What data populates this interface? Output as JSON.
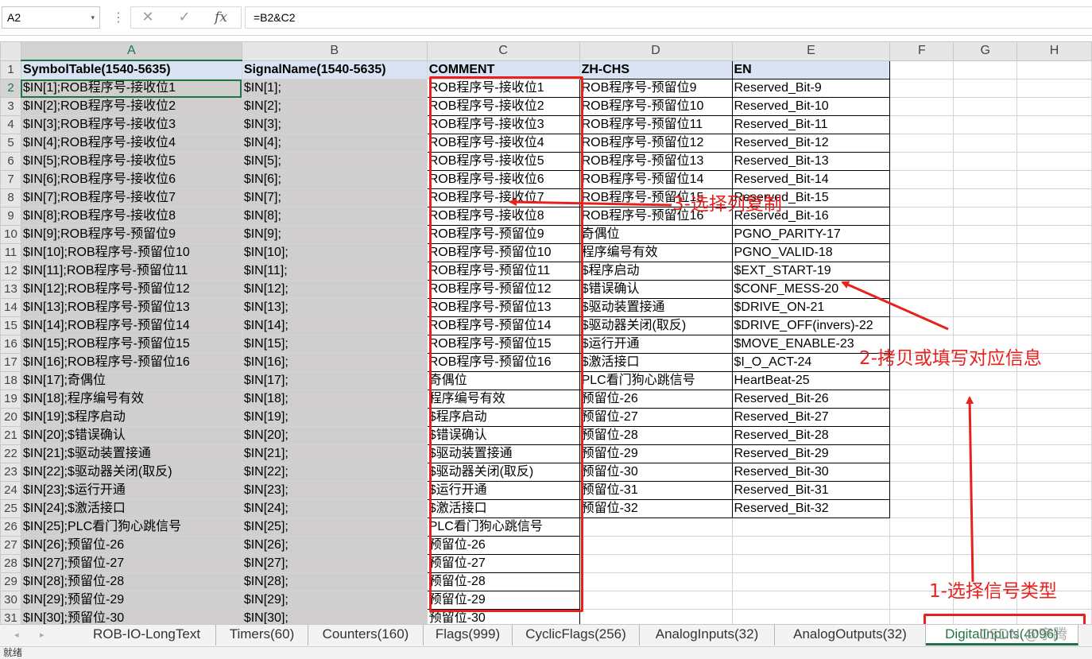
{
  "formula_bar": {
    "name_box": "A2",
    "name_box_arrow": "▾",
    "separator": "⋮",
    "cancel_icon": "✕",
    "confirm_icon": "✓",
    "fx_icon": "fx",
    "formula": "=B2&C2"
  },
  "columns": [
    "A",
    "B",
    "C",
    "D",
    "E",
    "F",
    "G",
    "H"
  ],
  "rows": [
    {
      "num": "1",
      "cells": [
        "SymbolTable(1540-5635)",
        "SignalName(1540-5635)",
        "COMMENT",
        "ZH-CHS",
        "EN"
      ]
    },
    {
      "num": "2",
      "cells": [
        "$IN[1];ROB程序号-接收位1",
        "$IN[1];",
        "ROB程序号-接收位1",
        "ROB程序号-预留位9",
        "Reserved_Bit-9"
      ]
    },
    {
      "num": "3",
      "cells": [
        "$IN[2];ROB程序号-接收位2",
        "$IN[2];",
        "ROB程序号-接收位2",
        "ROB程序号-预留位10",
        "Reserved_Bit-10"
      ]
    },
    {
      "num": "4",
      "cells": [
        "$IN[3];ROB程序号-接收位3",
        "$IN[3];",
        "ROB程序号-接收位3",
        "ROB程序号-预留位11",
        "Reserved_Bit-11"
      ]
    },
    {
      "num": "5",
      "cells": [
        "$IN[4];ROB程序号-接收位4",
        "$IN[4];",
        "ROB程序号-接收位4",
        "ROB程序号-预留位12",
        "Reserved_Bit-12"
      ]
    },
    {
      "num": "6",
      "cells": [
        "$IN[5];ROB程序号-接收位5",
        "$IN[5];",
        "ROB程序号-接收位5",
        "ROB程序号-预留位13",
        "Reserved_Bit-13"
      ]
    },
    {
      "num": "7",
      "cells": [
        "$IN[6];ROB程序号-接收位6",
        "$IN[6];",
        "ROB程序号-接收位6",
        "ROB程序号-预留位14",
        "Reserved_Bit-14"
      ]
    },
    {
      "num": "8",
      "cells": [
        "$IN[7];ROB程序号-接收位7",
        "$IN[7];",
        "ROB程序号-接收位7",
        "ROB程序号-预留位15",
        "Reserved_Bit-15"
      ]
    },
    {
      "num": "9",
      "cells": [
        "$IN[8];ROB程序号-接收位8",
        "$IN[8];",
        "ROB程序号-接收位8",
        "ROB程序号-预留位16",
        "Reserved_Bit-16"
      ]
    },
    {
      "num": "10",
      "cells": [
        "$IN[9];ROB程序号-预留位9",
        "$IN[9];",
        "ROB程序号-预留位9",
        "奇偶位",
        "PGNO_PARITY-17"
      ]
    },
    {
      "num": "11",
      "cells": [
        "$IN[10];ROB程序号-预留位10",
        "$IN[10];",
        "ROB程序号-预留位10",
        "程序编号有效",
        "PGNO_VALID-18"
      ]
    },
    {
      "num": "12",
      "cells": [
        "$IN[11];ROB程序号-预留位11",
        "$IN[11];",
        "ROB程序号-预留位11",
        "$程序启动",
        "$EXT_START-19"
      ]
    },
    {
      "num": "13",
      "cells": [
        "$IN[12];ROB程序号-预留位12",
        "$IN[12];",
        "ROB程序号-预留位12",
        "$错误确认",
        "$CONF_MESS-20"
      ]
    },
    {
      "num": "14",
      "cells": [
        "$IN[13];ROB程序号-预留位13",
        "$IN[13];",
        "ROB程序号-预留位13",
        "$驱动装置接通",
        "$DRIVE_ON-21"
      ]
    },
    {
      "num": "15",
      "cells": [
        "$IN[14];ROB程序号-预留位14",
        "$IN[14];",
        "ROB程序号-预留位14",
        "$驱动器关闭(取反)",
        "$DRIVE_OFF(invers)-22"
      ]
    },
    {
      "num": "16",
      "cells": [
        "$IN[15];ROB程序号-预留位15",
        "$IN[15];",
        "ROB程序号-预留位15",
        "$运行开通",
        "$MOVE_ENABLE-23"
      ]
    },
    {
      "num": "17",
      "cells": [
        "$IN[16];ROB程序号-预留位16",
        "$IN[16];",
        "ROB程序号-预留位16",
        "$激活接口",
        "$I_O_ACT-24"
      ]
    },
    {
      "num": "18",
      "cells": [
        "$IN[17];奇偶位",
        "$IN[17];",
        "奇偶位",
        "PLC看门狗心跳信号",
        "HeartBeat-25"
      ]
    },
    {
      "num": "19",
      "cells": [
        "$IN[18];程序编号有效",
        "$IN[18];",
        "程序编号有效",
        "预留位-26",
        "Reserved_Bit-26"
      ]
    },
    {
      "num": "20",
      "cells": [
        "$IN[19];$程序启动",
        "$IN[19];",
        "$程序启动",
        "预留位-27",
        "Reserved_Bit-27"
      ]
    },
    {
      "num": "21",
      "cells": [
        "$IN[20];$错误确认",
        "$IN[20];",
        "$错误确认",
        "预留位-28",
        "Reserved_Bit-28"
      ]
    },
    {
      "num": "22",
      "cells": [
        "$IN[21];$驱动装置接通",
        "$IN[21];",
        "$驱动装置接通",
        "预留位-29",
        "Reserved_Bit-29"
      ]
    },
    {
      "num": "23",
      "cells": [
        "$IN[22];$驱动器关闭(取反)",
        "$IN[22];",
        "$驱动器关闭(取反)",
        "预留位-30",
        "Reserved_Bit-30"
      ]
    },
    {
      "num": "24",
      "cells": [
        "$IN[23];$运行开通",
        "$IN[23];",
        "$运行开通",
        "预留位-31",
        "Reserved_Bit-31"
      ]
    },
    {
      "num": "25",
      "cells": [
        "$IN[24];$激活接口",
        "$IN[24];",
        "$激活接口",
        "预留位-32",
        "Reserved_Bit-32"
      ]
    },
    {
      "num": "26",
      "cells": [
        "$IN[25];PLC看门狗心跳信号",
        "$IN[25];",
        "PLC看门狗心跳信号",
        "",
        ""
      ]
    },
    {
      "num": "27",
      "cells": [
        "$IN[26];预留位-26",
        "$IN[26];",
        "预留位-26",
        "",
        ""
      ]
    },
    {
      "num": "28",
      "cells": [
        "$IN[27];预留位-27",
        "$IN[27];",
        "预留位-27",
        "",
        ""
      ]
    },
    {
      "num": "29",
      "cells": [
        "$IN[28];预留位-28",
        "$IN[28];",
        "预留位-28",
        "",
        ""
      ]
    },
    {
      "num": "30",
      "cells": [
        "$IN[29];预留位-29",
        "$IN[29];",
        "预留位-29",
        "",
        ""
      ]
    },
    {
      "num": "31",
      "cells": [
        "$IN[30];预留位-30",
        "$IN[30];",
        "预留位-30",
        "",
        ""
      ]
    }
  ],
  "sheet_tabs": {
    "nav_prev": "◂",
    "nav_next": "▸",
    "tabs": [
      {
        "label": "ROB-IO-LongText",
        "active": false
      },
      {
        "label": "Timers(60)",
        "active": false
      },
      {
        "label": "Counters(160)",
        "active": false
      },
      {
        "label": "Flags(999)",
        "active": false
      },
      {
        "label": "CyclicFlags(256)",
        "active": false
      },
      {
        "label": "AnalogInputs(32)",
        "active": false
      },
      {
        "label": "AnalogOutputs(32)",
        "active": false
      },
      {
        "label": "DigitalInputs(4096)",
        "active": true
      }
    ]
  },
  "status_bar": {
    "text": "就绪"
  },
  "annotations": {
    "step1": "1-选择信号类型",
    "step2": "2-拷贝或填写对应信息",
    "step3": "3-选择列复制",
    "color": "#e8211d"
  },
  "watermark": "CSDN @宇腾"
}
